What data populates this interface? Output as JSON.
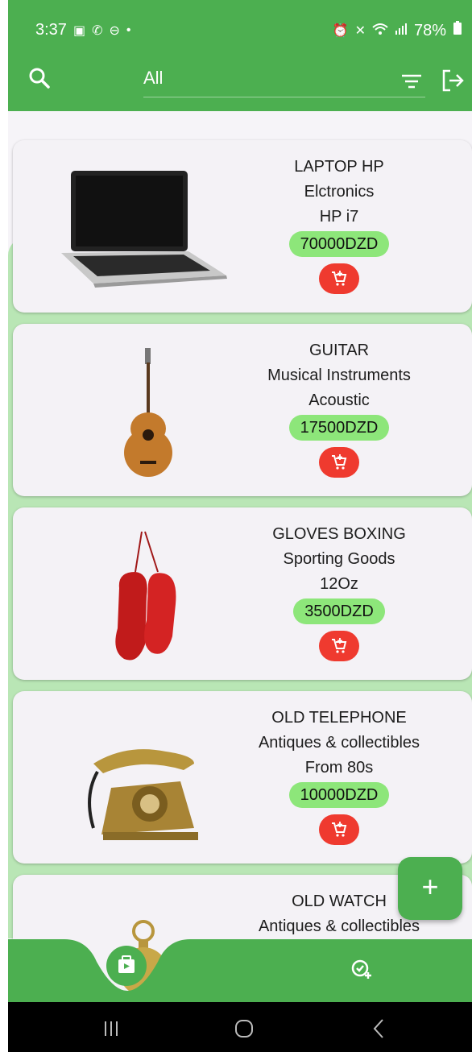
{
  "status_bar": {
    "time": "3:37",
    "battery": "78%",
    "icons": [
      "gallery-icon",
      "call-icon",
      "dnd-icon",
      "dot-icon",
      "alarm-icon",
      "mute-icon",
      "wifi-icon",
      "signal-icon",
      "battery-icon"
    ]
  },
  "app_bar": {
    "category": "All",
    "icons": [
      "search-icon",
      "filter-icon",
      "logout-icon"
    ]
  },
  "products": [
    {
      "name": "LAPTOP HP",
      "category": "Elctronics",
      "detail": "HP i7",
      "price": "70000DZD",
      "image": "laptop"
    },
    {
      "name": "GUITAR",
      "category": "Musical Instruments",
      "detail": "Acoustic",
      "price": "17500DZD",
      "image": "guitar"
    },
    {
      "name": "GLOVES BOXING",
      "category": "Sporting Goods",
      "detail": "12Oz",
      "price": "3500DZD",
      "image": "boxing-gloves"
    },
    {
      "name": "OLD TELEPHONE",
      "category": "Antiques & collectibles",
      "detail": "From 80s",
      "price": "10000DZD",
      "image": "old-telephone"
    },
    {
      "name": "OLD WATCH",
      "category": "Antiques & collectibles",
      "detail": "",
      "price": "",
      "image": "pocket-watch"
    }
  ],
  "fab": {
    "label": "+"
  },
  "bottom_nav": {
    "icons": [
      "products-icon",
      "check-add-icon"
    ]
  },
  "colors": {
    "primary": "#4caf50",
    "list_bg": "#b9e6b5",
    "price_bg": "#8de67a",
    "cart": "#ef3a2f"
  }
}
